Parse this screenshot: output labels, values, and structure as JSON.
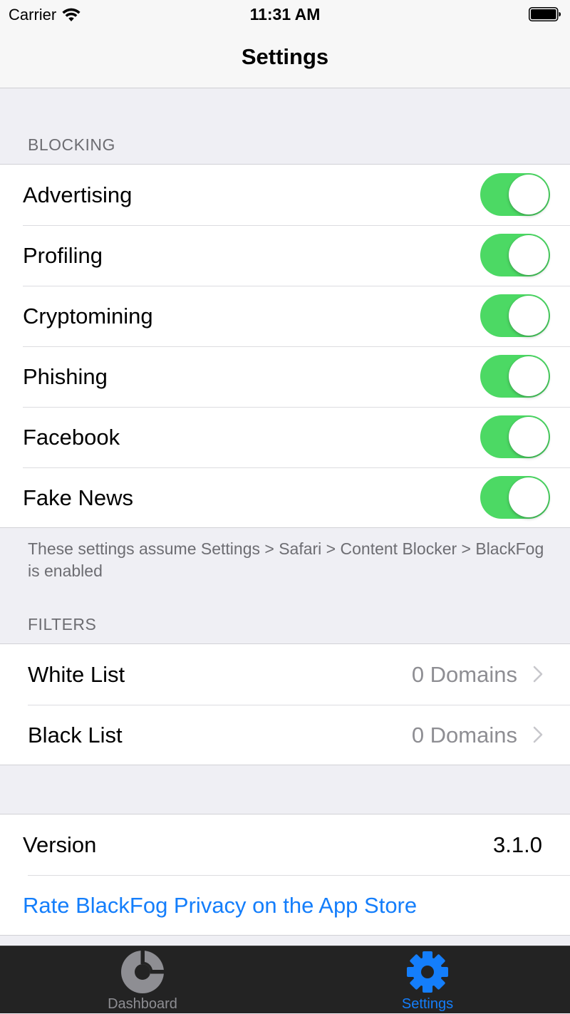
{
  "status_bar": {
    "carrier": "Carrier",
    "time": "11:31 AM"
  },
  "nav": {
    "title": "Settings"
  },
  "blocking": {
    "header": "BLOCKING",
    "items": [
      {
        "label": "Advertising",
        "on": true
      },
      {
        "label": "Profiling",
        "on": true
      },
      {
        "label": "Cryptomining",
        "on": true
      },
      {
        "label": "Phishing",
        "on": true
      },
      {
        "label": "Facebook",
        "on": true
      },
      {
        "label": "Fake News",
        "on": true
      }
    ],
    "footer": "These settings assume Settings > Safari > Content Blocker > BlackFog is enabled"
  },
  "filters": {
    "header": "FILTERS",
    "items": [
      {
        "label": "White List",
        "detail": "0 Domains"
      },
      {
        "label": "Black List",
        "detail": "0 Domains"
      }
    ]
  },
  "info": {
    "version_label": "Version",
    "version_value": "3.1.0",
    "rate_label": "Rate BlackFog Privacy on the App Store"
  },
  "tab_bar": {
    "tabs": [
      {
        "label": "Dashboard",
        "active": false
      },
      {
        "label": "Settings",
        "active": true
      }
    ]
  },
  "colors": {
    "toggle_on": "#4cd964",
    "accent": "#147efb",
    "tab_inactive": "#8e8e93",
    "tab_bar_bg": "#232323"
  }
}
